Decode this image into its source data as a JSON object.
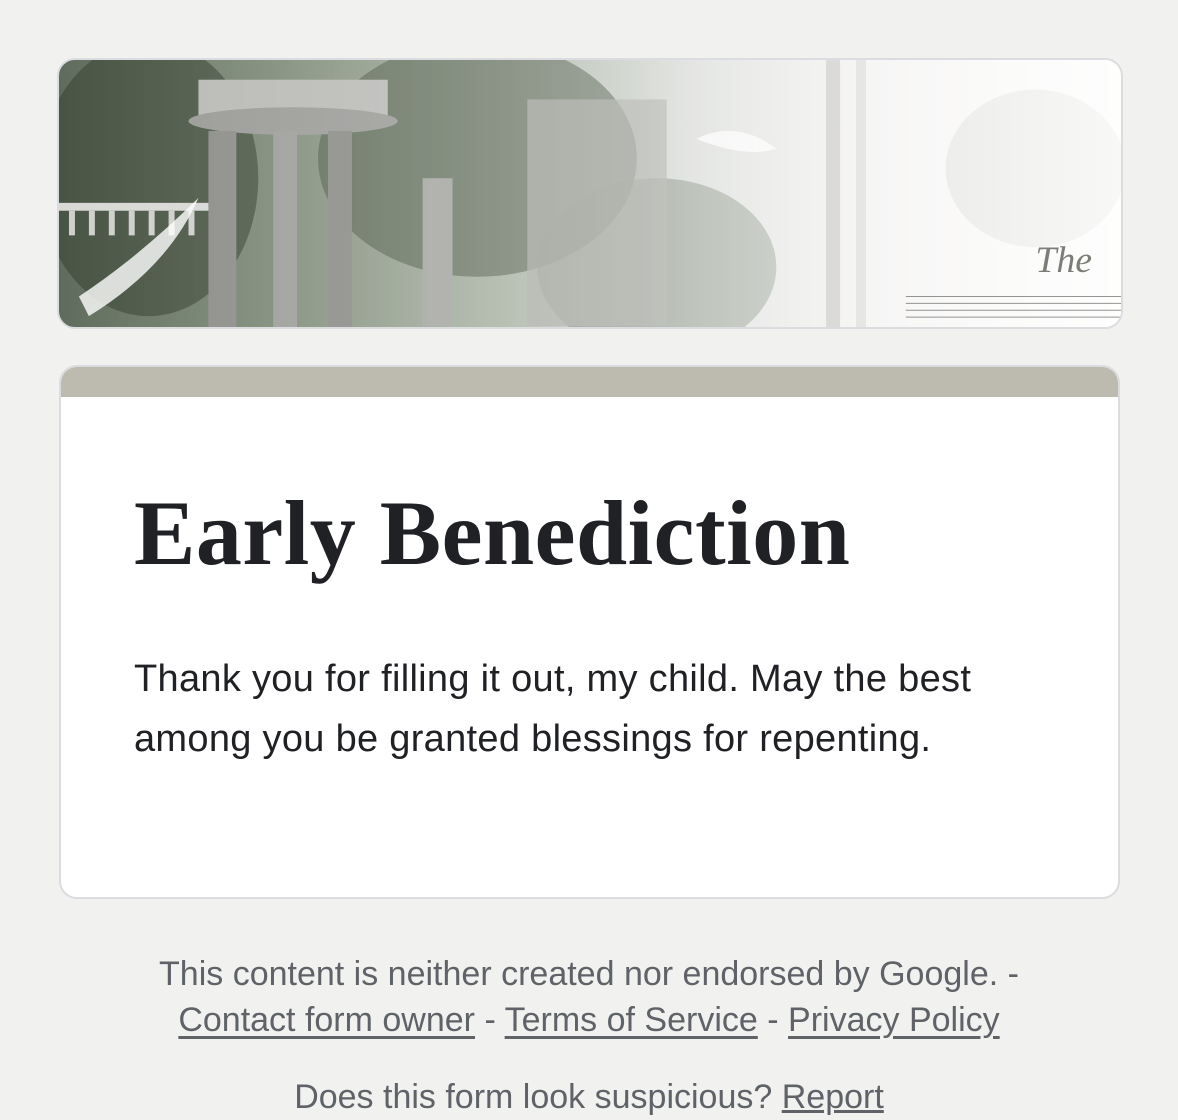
{
  "form": {
    "title": "Early Benediction",
    "message": "Thank you for filling it out, my child. May the best among you be granted blessings for repenting.",
    "accent_color": "#bdbbaf"
  },
  "banner": {
    "image_text": "The",
    "icon": "header-image"
  },
  "footer": {
    "disclaimer": "This content is neither created nor endorsed by Google. -",
    "contact_link": "Contact form owner",
    "separator": "-",
    "terms_link": "Terms of Service",
    "privacy_link": "Privacy Policy",
    "suspicious_text": "Does this form look suspicious?",
    "report_link": "Report"
  }
}
